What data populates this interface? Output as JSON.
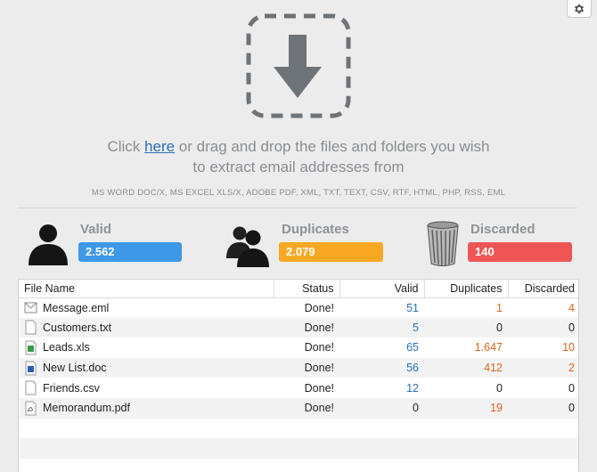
{
  "instructions": {
    "prefix": "Click",
    "link": "here",
    "suffix": " or drag and drop the files and folders you wish",
    "line2": "to extract email addresses from"
  },
  "formats": "MS WORD DOC/X, MS EXCEL XLS/X, ADOBE PDF, XML, TXT, TEXT, CSV, RTF, HTML, PHP, RSS, EML",
  "stats": {
    "valid": {
      "label": "Valid",
      "value": "2.562",
      "color": "#3d98e8"
    },
    "duplicates": {
      "label": "Duplicates",
      "value": "2.079",
      "color": "#f8a825"
    },
    "discarded": {
      "label": "Discarded",
      "value": "140",
      "color": "#ee5656"
    }
  },
  "table": {
    "columns": [
      "File Name",
      "Status",
      "Valid",
      "Duplicates",
      "Discarded"
    ],
    "rows": [
      {
        "name": "Message.eml",
        "icon": "email-file-icon",
        "status": "Done!",
        "valid": "51",
        "duplicates": "1",
        "discarded": "4"
      },
      {
        "name": "Customers.txt",
        "icon": "text-file-icon",
        "status": "Done!",
        "valid": "5",
        "duplicates": "0",
        "discarded": "0"
      },
      {
        "name": "Leads.xls",
        "icon": "spreadsheet-file-icon",
        "status": "Done!",
        "valid": "65",
        "duplicates": "1.647",
        "discarded": "10"
      },
      {
        "name": "New List.doc",
        "icon": "document-file-icon",
        "status": "Done!",
        "valid": "56",
        "duplicates": "412",
        "discarded": "2"
      },
      {
        "name": "Friends.csv",
        "icon": "csv-file-icon",
        "status": "Done!",
        "valid": "12",
        "duplicates": "0",
        "discarded": "0"
      },
      {
        "name": "Memorandum.pdf",
        "icon": "pdf-file-icon",
        "status": "Done!",
        "valid": "0",
        "duplicates": "19",
        "discarded": "0"
      }
    ]
  },
  "colors": {
    "accent_blue": "#2a6fb8",
    "accent_orange": "#d9641e"
  }
}
